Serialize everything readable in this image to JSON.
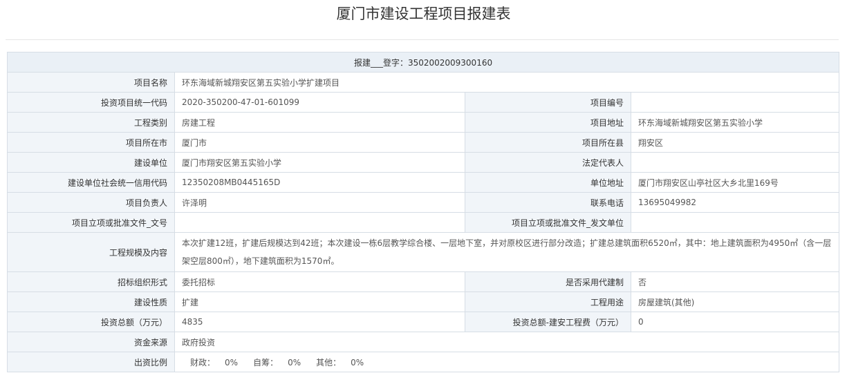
{
  "page": {
    "title": "厦门市建设工程项目报建表"
  },
  "header": {
    "registration": "报建___登字：3502002009300160"
  },
  "fields": {
    "project_name_label": "项目名称",
    "project_name": "环东海域新城翔安区第五实验小学扩建项目",
    "invest_code_label": "投资项目统一代码",
    "invest_code": "2020-350200-47-01-601099",
    "project_no_label": "项目编号",
    "project_no": "",
    "eng_type_label": "工程类别",
    "eng_type": "房建工程",
    "project_addr_label": "项目地址",
    "project_addr": "环东海域新城翔安区第五实验小学",
    "city_label": "项目所在市",
    "city": "厦门市",
    "county_label": "项目所在县",
    "county": "翔安区",
    "builder_label": "建设单位",
    "builder": "厦门市翔安区第五实验小学",
    "legal_rep_label": "法定代表人",
    "legal_rep": "",
    "credit_code_label": "建设单位社会统一信用代码",
    "credit_code": "12350208MB0445165D",
    "unit_addr_label": "单位地址",
    "unit_addr": "厦门市翔安区山亭社区大乡北里169号",
    "manager_label": "项目负责人",
    "manager": "许泽明",
    "phone_label": "联系电话",
    "phone": "13695049982",
    "approval_no_label": "项目立项或批准文件_文号",
    "approval_no": "",
    "approval_unit_label": "项目立项或批准文件_发文单位",
    "approval_unit": "",
    "scale_label": "工程规模及内容",
    "scale": "本次扩建12班，扩建后规模达到42班；本次建设一栋6层教学综合楼、一层地下室，并对原校区进行部分改造；扩建总建筑面积6520㎡，其中：地上建筑面积为4950㎡（含一层架空层800㎡），地下建筑面积为1570㎡。",
    "bidding_label": "招标组织形式",
    "bidding": "委托招标",
    "agent_label": "是否采用代建制",
    "agent": "否",
    "nature_label": "建设性质",
    "nature": "扩建",
    "usage_label": "工程用途",
    "usage": "房屋建筑(其他)",
    "total_invest_label": "投资总额（万元）",
    "total_invest": "4835",
    "install_cost_label": "投资总额-建安工程费（万元）",
    "install_cost": "0",
    "fund_source_label": "资金来源",
    "fund_source": "政府投资",
    "ratio_label": "出资比例",
    "ratio": {
      "fiscal_label": "财政：",
      "fiscal": "0%",
      "self_label": "自筹：",
      "self": "0%",
      "other_label": "其他：",
      "other": "0%"
    }
  }
}
